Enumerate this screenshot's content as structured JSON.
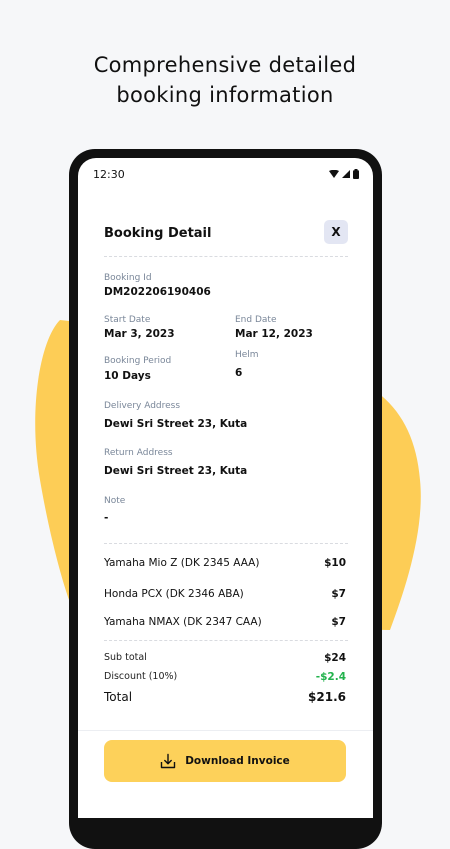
{
  "headline": {
    "line1": "Comprehensive detailed",
    "line2": "booking information"
  },
  "status_bar": {
    "time": "12:30"
  },
  "booking": {
    "title": "Booking Detail",
    "close_label": "X",
    "booking_id_label": "Booking Id",
    "booking_id": "DM202206190406",
    "start_date_label": "Start Date",
    "start_date": "Mar 3, 2023",
    "end_date_label": "End Date",
    "end_date": "Mar 12, 2023",
    "period_label": "Booking Period",
    "period": "10 Days",
    "helm_label": "Helm",
    "helm": "6",
    "delivery_label": "Delivery Address",
    "delivery_address": "Dewi Sri Street 23, Kuta",
    "return_label": "Return Address",
    "return_address": "Dewi Sri Street 23, Kuta",
    "note_label": "Note",
    "note": "-"
  },
  "items": [
    {
      "name": "Yamaha Mio Z (DK 2345 AAA)",
      "price": "$10"
    },
    {
      "name": "Honda PCX (DK 2346 ABA)",
      "price": "$7"
    },
    {
      "name": "Yamaha NMAX (DK 2347 CAA)",
      "price": "$7"
    }
  ],
  "summary": {
    "subtotal_label": "Sub total",
    "subtotal": "$24",
    "discount_label": "Discount (10%)",
    "discount": "-$2.4",
    "total_label": "Total",
    "total": "$21.6"
  },
  "download_label": "Download Invoice",
  "colors": {
    "accent": "#fdd15a",
    "blob": "#fdcd56",
    "discount": "#22b24c",
    "label": "#7a8799"
  }
}
